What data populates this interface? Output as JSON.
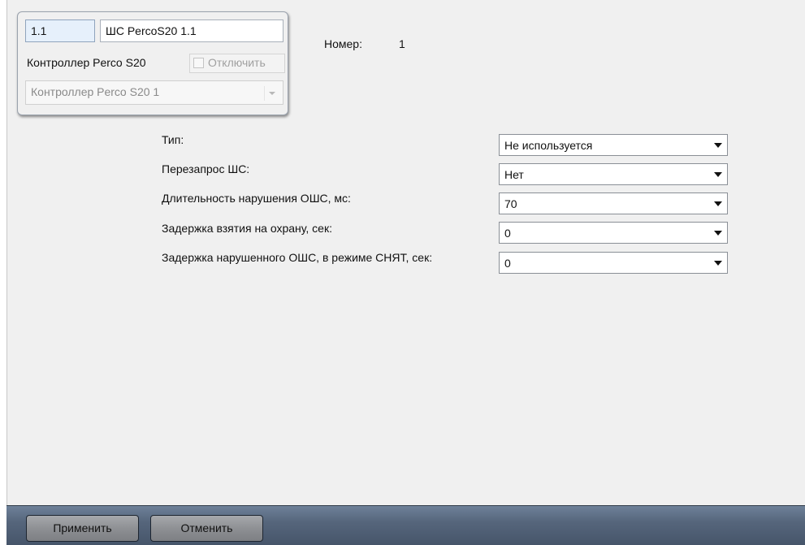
{
  "header": {
    "id_value": "1.1",
    "name_value": "ШС PercoS20 1.1",
    "controller_label": "Контроллер Perco S20",
    "disable_label": "Отключить",
    "controller_select_value": "Контроллер Perco S20 1"
  },
  "number": {
    "label": "Номер:",
    "value": "1"
  },
  "settings": [
    {
      "label": "Тип:",
      "value": "Не используется"
    },
    {
      "label": "Перезапрос ШС:",
      "value": "Нет"
    },
    {
      "label": "Длительность нарушения ОШС, мс:",
      "value": "70"
    },
    {
      "label": "Задержка взятия на охрану, сек:",
      "value": "0"
    },
    {
      "label": "Задержка нарушенного ОШС, в режиме СНЯТ, сек:",
      "value": "0"
    }
  ],
  "footer": {
    "apply_label": "Применить",
    "cancel_label": "Отменить"
  }
}
